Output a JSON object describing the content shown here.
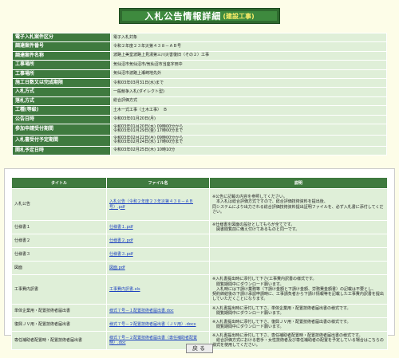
{
  "title": {
    "main": "入札公告情報詳細",
    "sub": "(建設工事)"
  },
  "info": [
    {
      "label": "電子入札案件区分",
      "value": "電子入札対象"
    },
    {
      "label": "調達案件番号",
      "value": "令和２年度２３年災第４３８－ＡＢ号"
    },
    {
      "label": "調達案件名称",
      "value": "波路上美堂波路上見湯第三川災害復旧（その２）工事"
    },
    {
      "label": "工事場所",
      "value": "気仙沼市気仙沼市/気仙沼市当座字田中"
    },
    {
      "label": "工事場所",
      "value": "気仙沼市波路上瀬崎地先外"
    },
    {
      "label": "施工日数又は完成期限",
      "value": "令和03年03月31日(水)まで"
    },
    {
      "label": "入札方式",
      "value": "一般競争入札(ダイレクト型)"
    },
    {
      "label": "落札方式",
      "value": "総合評価方式"
    },
    {
      "label": "工種(等級)",
      "value": "土木一式工事（土木工事）　Ｂ"
    },
    {
      "label": "公告日時",
      "value": "令和03年01月20日(月)"
    },
    {
      "label": "参加申請受付期間",
      "value": "令和03年01月20日(水) 09時00分から\n令和03年01月29日(金) 17時00分まで",
      "tall": true
    },
    {
      "label": "入札書受付予定期間",
      "value": "令和03年02月22日(月) 09時00分から\n令和03年02月24日(水) 17時00分まで",
      "tall": true
    },
    {
      "label": "開札予定日時",
      "value": "令和03年02月25日(木) 10時10分"
    }
  ],
  "files_header": {
    "title": "タイトル",
    "file": "ファイル名",
    "desc": "説明"
  },
  "files": [
    {
      "title": "入札公告",
      "file": "入札公告（令和２年度２３年災第４３８－ＡＢ号）.pdf",
      "desc": "※公告に記載の内容を参照してください。\n　本入札は総合評価方式ですので、総合評価技術資料を提出後、\n同システムにより出力される総合評価技術資料提出証明ファイルを、必ず入札書に添付してください。"
    },
    {
      "title": "仕様書１",
      "file": "仕様書１.pdf",
      "desc": "※仕様書を図面の設計としてもらが全てです。\n　図書閲覧前に備え付けてあるものと同一です。"
    },
    {
      "title": "仕様書２",
      "file": "仕様書２.pdf",
      "desc": ""
    },
    {
      "title": "仕様書３",
      "file": "仕様書３.pdf",
      "desc": ""
    },
    {
      "title": "図面",
      "file": "図面.pdf",
      "desc": ""
    },
    {
      "title": "工事費内訳書",
      "file": "工事費内訳書.xls",
      "desc": "※入札書提出時に添付して下さ(工事費内訳書の様式です。\n　閲覧期間中にダウンロード願います。\n　入札時には下請け業務等（下請け金額と下請け金額、労務費金額書）の記載は不要とし、\n契約締結後の下請け承認申請時に、工事請負者から下請け情報等を記載した工事費内訳書を提出していただくことになります。"
    },
    {
      "title": "単体企業用・配置技術者届出書",
      "file": "様式７号－１配置技術者届出書.doc",
      "desc": "※入札書提出時に添付して下さ、単体企業用・配置技術者届出書の様式です。\n　閲覧期間中にダウンロード願います。"
    },
    {
      "title": "復興ＪＶ用・配置技術者届出書",
      "file": "様式７号－２配置技術者届出書（ＪＶ用）.docx",
      "desc": "※入札書提出時に添付して下さ、復興ＪＶ用・配置技術者届出書の様式です。\n　閲覧期間中にダウンロード願います。"
    },
    {
      "title": "専任補助者配置時・配置技術者届出書",
      "file": "様式７号－２配置技術者届出書（専任補助者配置時）.doc",
      "desc": "※入札書提出時に添付して下さ、専任補助者配置時・配置技術者届出書の様式です。\n　総合評価方式における若手・女性技術者及び専任補助者の配置を予定している場合はこちらの様式を使用してください。"
    }
  ],
  "back_label": "戻る"
}
